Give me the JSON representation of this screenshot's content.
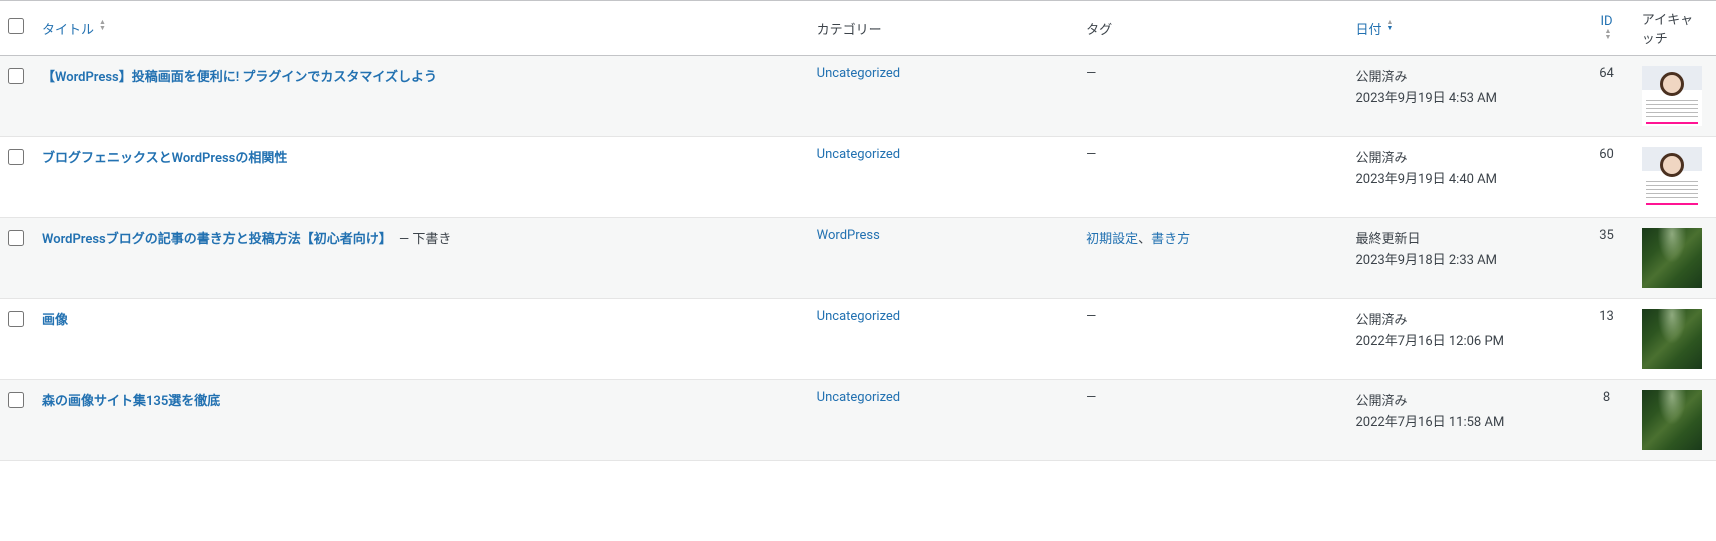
{
  "columns": {
    "title": "タイトル",
    "categories": "カテゴリー",
    "tags": "タグ",
    "date": "日付",
    "id": "ID",
    "thumbnail": "アイキャッチ"
  },
  "draft_suffix": "— 下書き",
  "no_tags": "—",
  "posts": [
    {
      "title": "【WordPress】投稿画面を便利に! プラグインでカスタマイズしよう",
      "is_draft": false,
      "categories": [
        "Uncategorized"
      ],
      "tags": [],
      "date_status": "公開済み",
      "date_time": "2023年9月19日 4:53 AM",
      "id": "64",
      "thumb_type": "profile"
    },
    {
      "title": "ブログフェニックスとWordPressの相関性",
      "is_draft": false,
      "categories": [
        "Uncategorized"
      ],
      "tags": [],
      "date_status": "公開済み",
      "date_time": "2023年9月19日 4:40 AM",
      "id": "60",
      "thumb_type": "profile"
    },
    {
      "title": "WordPressブログの記事の書き方と投稿方法【初心者向け】",
      "is_draft": true,
      "categories": [
        "WordPress"
      ],
      "tags": [
        "初期設定",
        "書き方"
      ],
      "date_status": "最終更新日",
      "date_time": "2023年9月18日 2:33 AM",
      "id": "35",
      "thumb_type": "forest"
    },
    {
      "title": "画像",
      "is_draft": false,
      "categories": [
        "Uncategorized"
      ],
      "tags": [],
      "date_status": "公開済み",
      "date_time": "2022年7月16日 12:06 PM",
      "id": "13",
      "thumb_type": "forest"
    },
    {
      "title": "森の画像サイト集135選を徹底",
      "is_draft": false,
      "categories": [
        "Uncategorized"
      ],
      "tags": [],
      "date_status": "公開済み",
      "date_time": "2022年7月16日 11:58 AM",
      "id": "8",
      "thumb_type": "forest"
    }
  ]
}
